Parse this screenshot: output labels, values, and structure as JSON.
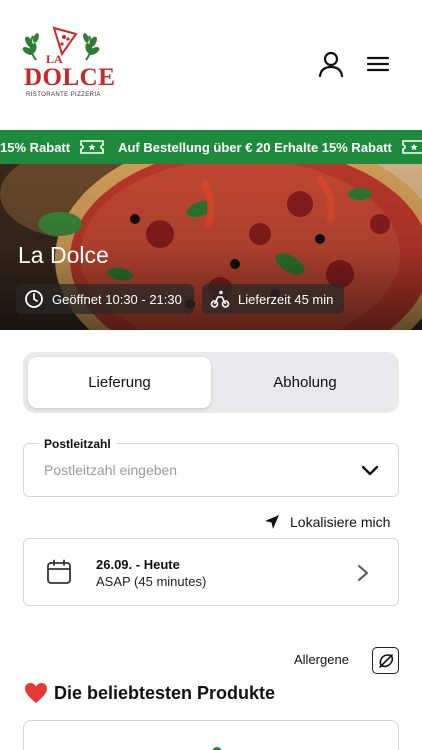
{
  "header": {
    "logo": {
      "top_text": "LA",
      "word": "DOLCE",
      "sub": "RISTORANTE PIZZERIA"
    },
    "icons": [
      "user-icon",
      "menu-icon"
    ]
  },
  "promo": {
    "items": [
      {
        "text": "15% Rabatt",
        "icon": "ticket-icon"
      },
      {
        "text": "Auf Bestellung über € 20 Erhalte 15% Rabatt",
        "icon": "ticket-icon"
      }
    ],
    "colors": {
      "background": "#1e8a3c",
      "text": "#ffffff"
    }
  },
  "hero": {
    "title": "La Dolce",
    "opening": "Geöffnet 10:30 - 21:30",
    "delivery_time": "Lieferzeit 45 min"
  },
  "order_type": {
    "options": [
      "Lieferung",
      "Abholung"
    ],
    "selected": "Lieferung"
  },
  "zip": {
    "label": "Postleitzahl",
    "placeholder": "Postleitzahl eingeben",
    "value": ""
  },
  "locate": {
    "label": "Lokalisiere mich"
  },
  "date": {
    "main": "26.09. - Heute",
    "sub": "ASAP (45 minutes)"
  },
  "allergens": {
    "label": "Allergene"
  },
  "popular": {
    "title": "Die beliebtesten Produkte"
  },
  "colors": {
    "accent_green": "#1e8a3c",
    "logo_red": "#c62828",
    "segment_bg": "#e9e9eb"
  }
}
